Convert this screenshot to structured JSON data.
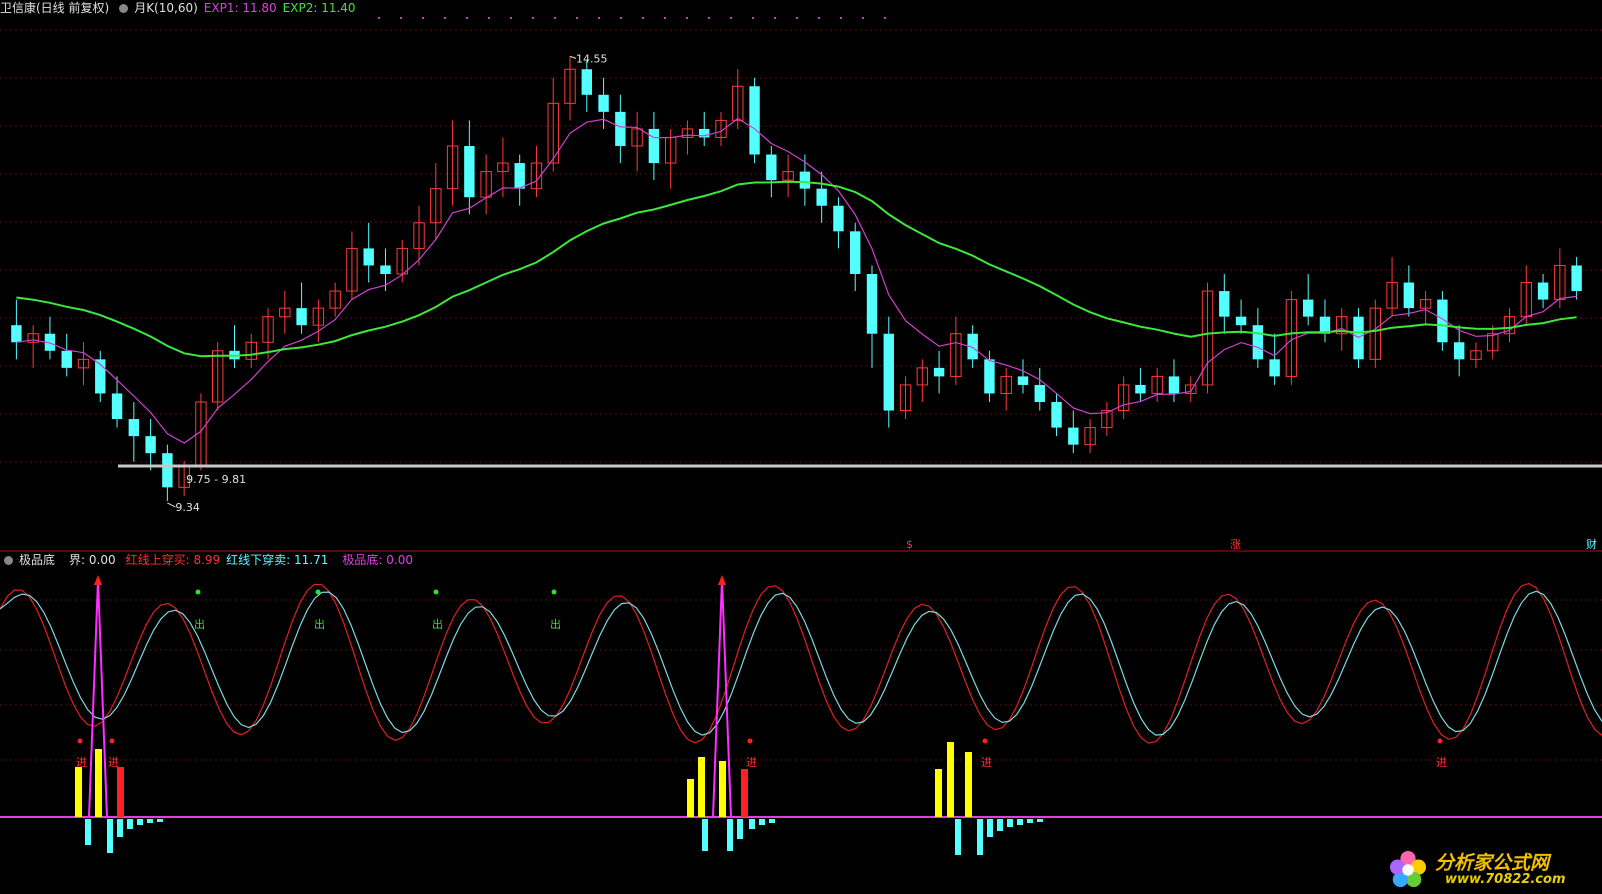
{
  "top_header": {
    "stock": "卫信康(日线 前复权)",
    "indicator": "月K(10,60)",
    "exp1_label": "EXP1: 11.80",
    "exp2_label": "EXP2: 11.40"
  },
  "indicator_header": {
    "name": "极品底",
    "jie": "界: 0.00",
    "red_cross_up": "红线上穿买: 8.99",
    "red_cross_down": "红线下穿卖: 11.71",
    "jipindi": "极品底: 0.00"
  },
  "annotations": {
    "high": "14.55",
    "low": "9.34",
    "range": "9.75 - 9.81",
    "markers": [
      "$",
      "涨",
      "财"
    ],
    "buy": "进",
    "sell": "出"
  },
  "watermark": {
    "title": "分析家公式网",
    "url": "www.70822.com"
  },
  "colors": {
    "up": "#ff3a3a",
    "down": "#54ffff",
    "ma_long": "#3ce83c",
    "ma_short": "#d040d0",
    "k_line": "#e02020",
    "d_line": "#7fd8e0",
    "spike": "#ff30ff",
    "yellow": "#ffff00"
  },
  "chart_data": [
    {
      "type": "candlestick",
      "title": "卫信康(日线 前复权)",
      "ylim": [
        9.0,
        15.0
      ],
      "series": [
        {
          "name": "EXP1",
          "last": 11.8
        },
        {
          "name": "EXP2",
          "last": 11.4
        }
      ],
      "candles": [
        [
          11.4,
          11.7,
          11.0,
          11.2
        ],
        [
          11.2,
          11.4,
          10.9,
          11.3
        ],
        [
          11.3,
          11.5,
          11.0,
          11.1
        ],
        [
          11.1,
          11.3,
          10.8,
          10.9
        ],
        [
          10.9,
          11.2,
          10.7,
          11.0
        ],
        [
          11.0,
          11.1,
          10.5,
          10.6
        ],
        [
          10.6,
          10.8,
          10.2,
          10.3
        ],
        [
          10.3,
          10.5,
          9.8,
          10.1
        ],
        [
          10.1,
          10.3,
          9.7,
          9.9
        ],
        [
          9.9,
          10.0,
          9.34,
          9.5
        ],
        [
          9.5,
          9.81,
          9.4,
          9.75
        ],
        [
          9.75,
          10.6,
          9.7,
          10.5
        ],
        [
          10.5,
          11.2,
          10.4,
          11.1
        ],
        [
          11.1,
          11.4,
          10.9,
          11.0
        ],
        [
          11.0,
          11.3,
          10.9,
          11.2
        ],
        [
          11.2,
          11.6,
          11.0,
          11.5
        ],
        [
          11.5,
          11.8,
          11.3,
          11.6
        ],
        [
          11.6,
          11.9,
          11.3,
          11.4
        ],
        [
          11.4,
          11.7,
          11.2,
          11.6
        ],
        [
          11.6,
          11.9,
          11.5,
          11.8
        ],
        [
          11.8,
          12.5,
          11.7,
          12.3
        ],
        [
          12.3,
          12.6,
          11.9,
          12.1
        ],
        [
          12.1,
          12.3,
          11.8,
          12.0
        ],
        [
          12.0,
          12.4,
          11.9,
          12.3
        ],
        [
          12.3,
          12.8,
          12.1,
          12.6
        ],
        [
          12.6,
          13.3,
          12.4,
          13.0
        ],
        [
          13.0,
          13.8,
          12.8,
          13.5
        ],
        [
          13.5,
          13.8,
          12.7,
          12.9
        ],
        [
          12.9,
          13.4,
          12.7,
          13.2
        ],
        [
          13.2,
          13.6,
          12.9,
          13.3
        ],
        [
          13.3,
          13.4,
          12.8,
          13.0
        ],
        [
          13.0,
          13.5,
          12.9,
          13.3
        ],
        [
          13.3,
          14.3,
          13.2,
          14.0
        ],
        [
          14.0,
          14.55,
          13.8,
          14.4
        ],
        [
          14.4,
          14.5,
          13.9,
          14.1
        ],
        [
          14.1,
          14.3,
          13.7,
          13.9
        ],
        [
          13.9,
          14.1,
          13.3,
          13.5
        ],
        [
          13.5,
          13.9,
          13.2,
          13.7
        ],
        [
          13.7,
          13.9,
          13.1,
          13.3
        ],
        [
          13.3,
          13.7,
          13.0,
          13.6
        ],
        [
          13.6,
          13.8,
          13.4,
          13.7
        ],
        [
          13.7,
          13.9,
          13.5,
          13.6
        ],
        [
          13.6,
          13.9,
          13.5,
          13.8
        ],
        [
          13.8,
          14.4,
          13.7,
          14.2
        ],
        [
          14.2,
          14.3,
          13.3,
          13.4
        ],
        [
          13.4,
          13.5,
          12.9,
          13.1
        ],
        [
          13.1,
          13.4,
          12.9,
          13.2
        ],
        [
          13.2,
          13.4,
          12.8,
          13.0
        ],
        [
          13.0,
          13.2,
          12.6,
          12.8
        ],
        [
          12.8,
          12.9,
          12.3,
          12.5
        ],
        [
          12.5,
          12.6,
          11.8,
          12.0
        ],
        [
          12.0,
          12.1,
          10.9,
          11.3
        ],
        [
          11.3,
          11.5,
          10.2,
          10.4
        ],
        [
          10.4,
          10.8,
          10.3,
          10.7
        ],
        [
          10.7,
          11.0,
          10.5,
          10.9
        ],
        [
          10.9,
          11.1,
          10.6,
          10.8
        ],
        [
          10.8,
          11.5,
          10.7,
          11.3
        ],
        [
          11.3,
          11.4,
          10.9,
          11.0
        ],
        [
          11.0,
          11.1,
          10.5,
          10.6
        ],
        [
          10.6,
          10.9,
          10.4,
          10.8
        ],
        [
          10.8,
          11.0,
          10.6,
          10.7
        ],
        [
          10.7,
          10.9,
          10.4,
          10.5
        ],
        [
          10.5,
          10.6,
          10.1,
          10.2
        ],
        [
          10.2,
          10.4,
          9.9,
          10.0
        ],
        [
          10.0,
          10.3,
          9.9,
          10.2
        ],
        [
          10.2,
          10.5,
          10.1,
          10.4
        ],
        [
          10.4,
          10.8,
          10.3,
          10.7
        ],
        [
          10.7,
          10.9,
          10.5,
          10.6
        ],
        [
          10.6,
          10.9,
          10.5,
          10.8
        ],
        [
          10.8,
          11.0,
          10.5,
          10.6
        ],
        [
          10.6,
          10.8,
          10.5,
          10.7
        ],
        [
          10.7,
          11.9,
          10.6,
          11.8
        ],
        [
          11.8,
          12.0,
          11.3,
          11.5
        ],
        [
          11.5,
          11.7,
          11.3,
          11.4
        ],
        [
          11.4,
          11.6,
          10.9,
          11.0
        ],
        [
          11.0,
          11.3,
          10.7,
          10.8
        ],
        [
          10.8,
          11.8,
          10.7,
          11.7
        ],
        [
          11.7,
          12.0,
          11.4,
          11.5
        ],
        [
          11.5,
          11.7,
          11.2,
          11.3
        ],
        [
          11.3,
          11.6,
          11.1,
          11.5
        ],
        [
          11.5,
          11.6,
          10.9,
          11.0
        ],
        [
          11.0,
          11.7,
          10.9,
          11.6
        ],
        [
          11.6,
          12.2,
          11.5,
          11.9
        ],
        [
          11.9,
          12.1,
          11.5,
          11.6
        ],
        [
          11.6,
          11.8,
          11.4,
          11.7
        ],
        [
          11.7,
          11.8,
          11.1,
          11.2
        ],
        [
          11.2,
          11.4,
          10.8,
          11.0
        ],
        [
          11.0,
          11.2,
          10.9,
          11.1
        ],
        [
          11.1,
          11.4,
          11.0,
          11.3
        ],
        [
          11.3,
          11.6,
          11.2,
          11.5
        ],
        [
          11.5,
          12.1,
          11.4,
          11.9
        ],
        [
          11.9,
          12.0,
          11.6,
          11.7
        ],
        [
          11.7,
          12.3,
          11.6,
          12.1
        ],
        [
          12.1,
          12.2,
          11.7,
          11.8
        ]
      ]
    },
    {
      "type": "line",
      "title": "极品底",
      "series": [
        {
          "name": "红线上穿买",
          "last": 8.99
        },
        {
          "name": "红线下穿卖",
          "last": 11.71
        },
        {
          "name": "极品底",
          "last": 0.0
        }
      ]
    }
  ]
}
